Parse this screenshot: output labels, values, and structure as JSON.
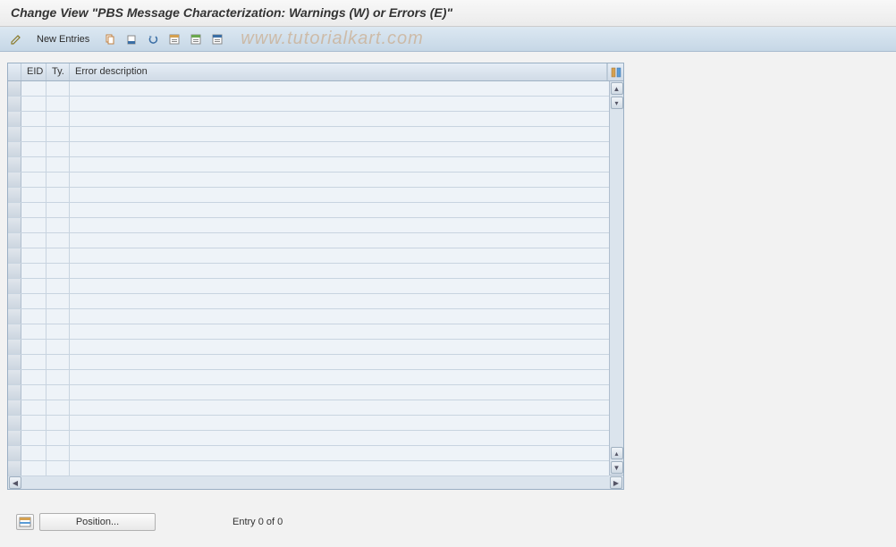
{
  "title": "Change View \"PBS Message Characterization: Warnings (W) or Errors (E)\"",
  "toolbar": {
    "new_entries": "New Entries"
  },
  "watermark": "www.tutorialkart.com",
  "table": {
    "headers": {
      "eid": "EID",
      "ty": "Ty.",
      "desc": "Error description"
    },
    "rows": [
      {
        "eid": "",
        "ty": "",
        "desc": ""
      },
      {
        "eid": "",
        "ty": "",
        "desc": ""
      },
      {
        "eid": "",
        "ty": "",
        "desc": ""
      },
      {
        "eid": "",
        "ty": "",
        "desc": ""
      },
      {
        "eid": "",
        "ty": "",
        "desc": ""
      },
      {
        "eid": "",
        "ty": "",
        "desc": ""
      },
      {
        "eid": "",
        "ty": "",
        "desc": ""
      },
      {
        "eid": "",
        "ty": "",
        "desc": ""
      },
      {
        "eid": "",
        "ty": "",
        "desc": ""
      },
      {
        "eid": "",
        "ty": "",
        "desc": ""
      },
      {
        "eid": "",
        "ty": "",
        "desc": ""
      },
      {
        "eid": "",
        "ty": "",
        "desc": ""
      },
      {
        "eid": "",
        "ty": "",
        "desc": ""
      },
      {
        "eid": "",
        "ty": "",
        "desc": ""
      },
      {
        "eid": "",
        "ty": "",
        "desc": ""
      },
      {
        "eid": "",
        "ty": "",
        "desc": ""
      },
      {
        "eid": "",
        "ty": "",
        "desc": ""
      },
      {
        "eid": "",
        "ty": "",
        "desc": ""
      },
      {
        "eid": "",
        "ty": "",
        "desc": ""
      },
      {
        "eid": "",
        "ty": "",
        "desc": ""
      },
      {
        "eid": "",
        "ty": "",
        "desc": ""
      },
      {
        "eid": "",
        "ty": "",
        "desc": ""
      },
      {
        "eid": "",
        "ty": "",
        "desc": ""
      },
      {
        "eid": "",
        "ty": "",
        "desc": ""
      },
      {
        "eid": "",
        "ty": "",
        "desc": ""
      },
      {
        "eid": "",
        "ty": "",
        "desc": ""
      }
    ]
  },
  "footer": {
    "position_label": "Position...",
    "entry_status": "Entry 0 of 0"
  }
}
